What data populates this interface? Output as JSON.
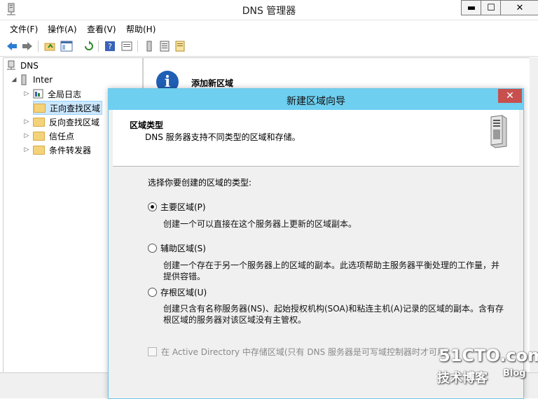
{
  "main_window": {
    "title": "DNS 管理器",
    "min_glyph": "▬",
    "max_glyph": "☐",
    "close_glyph": "✕"
  },
  "menu": [
    {
      "label": "文件(F)"
    },
    {
      "label": "操作(A)"
    },
    {
      "label": "查看(V)"
    },
    {
      "label": "帮助(H)"
    }
  ],
  "tree": {
    "root": "DNS",
    "server": "Inter",
    "items": [
      {
        "label": "全局日志"
      },
      {
        "label": "正向查找区域"
      },
      {
        "label": "反向查找区域"
      },
      {
        "label": "信任点"
      },
      {
        "label": "条件转发器"
      }
    ]
  },
  "right_pane": {
    "heading": "添加新区域",
    "info_glyph": "i"
  },
  "wizard": {
    "title": "新建区域向导",
    "close_glyph": "✕",
    "header_title": "区域类型",
    "header_desc": "DNS 服务器支持不同类型的区域和存储。",
    "prompt": "选择你要创建的区域的类型:",
    "options": [
      {
        "label": "主要区域(P)",
        "desc": "创建一个可以直接在这个服务器上更新的区域副本。",
        "selected": true
      },
      {
        "label": "辅助区域(S)",
        "desc": "创建一个存在于另一个服务器上的区域的副本。此选项帮助主服务器平衡处理的工作量，并提供容错。",
        "selected": false
      },
      {
        "label": "存根区域(U)",
        "desc": "创建只含有名称服务器(NS)、起始授权机构(SOA)和粘连主机(A)记录的区域的副本。含有存根区域的服务器对该区域没有主管权。",
        "selected": false
      }
    ],
    "ad_checkbox": "在 Active Directory 中存储区域(只有 DNS 服务器是可写域控制器时才可用)"
  },
  "watermark": {
    "main": "51CTO.com",
    "sub1": "技术博客",
    "sub2": "Blog"
  },
  "colors": {
    "wizard_title_bar": "#6ecff0",
    "close_red": "#c7504f",
    "selection": "#cce8ff"
  }
}
